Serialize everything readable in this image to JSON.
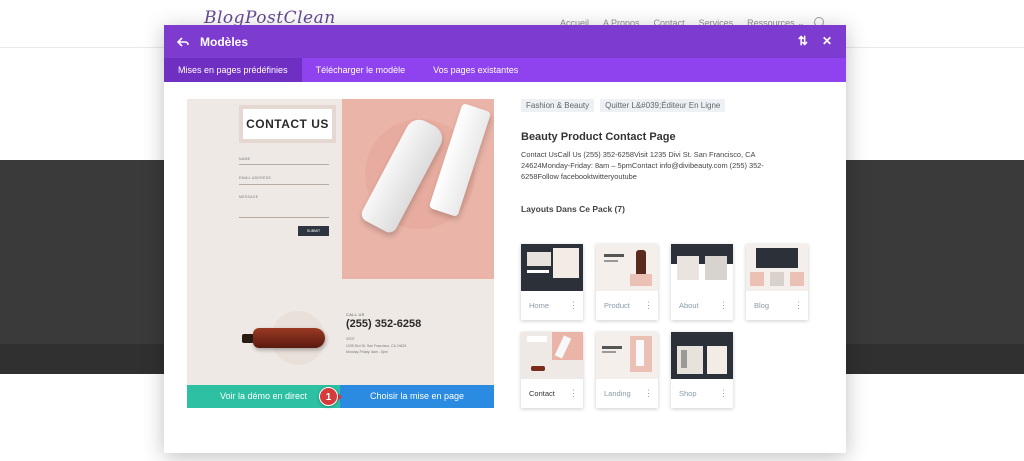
{
  "site": {
    "logo": "BlogPostClean",
    "nav": [
      "Accueil",
      "A Propos",
      "Contact",
      "Services",
      "Ressources ⌄"
    ]
  },
  "modal": {
    "title": "Modèles",
    "tabs": [
      {
        "label": "Mises en pages prédéfinies",
        "active": true
      },
      {
        "label": "Télécharger le modèle",
        "active": false
      },
      {
        "label": "Vos pages existantes",
        "active": false
      }
    ],
    "preview": {
      "heading": "CONTACT US",
      "field_name": "NAME",
      "field_email": "EMAIL ADDRESS",
      "field_message": "MESSAGE",
      "submit": "SUBMIT",
      "call_us": "CALL US",
      "phone": "(255) 352-6258",
      "visit": "VISIT",
      "address": "1235 Divi St. San Francisco, CA 24624",
      "hours": "Monday-Friday: 8am - 5pm"
    },
    "btn_demo": "Voir la démo en direct",
    "btn_choose": "Choisir la mise en page",
    "step_badge": "1",
    "tags": [
      "Fashion & Beauty",
      "Quitter L&#039;Éditeur En Ligne"
    ],
    "layout_name": "Beauty Product Contact Page",
    "layout_desc": "Contact UsCall Us (255) 352-6258Visit 1235 Divi St. San Francisco, CA 24624Monday-Friday: 8am – 5pmContact info@divibeauty.com (255) 352-6258Follow  facebooktwitteryoutube",
    "pack_title": "Layouts Dans Ce Pack (7)",
    "thumbs": [
      {
        "label": "Home",
        "dots": "⋮"
      },
      {
        "label": "Product",
        "dots": "⋮"
      },
      {
        "label": "About",
        "dots": "⋮"
      },
      {
        "label": "Blog",
        "dots": "⋮"
      },
      {
        "label": "Contact",
        "dots": "⋮"
      },
      {
        "label": "Landing",
        "dots": "⋮"
      },
      {
        "label": "Shop",
        "dots": "⋮"
      }
    ]
  },
  "colors": {
    "header_purple": "#7e3bd0",
    "tabs_purple": "#8f43ee",
    "demo_green": "#2ec0a3",
    "choose_blue": "#2a8be0",
    "badge_red": "#d63b3b"
  }
}
